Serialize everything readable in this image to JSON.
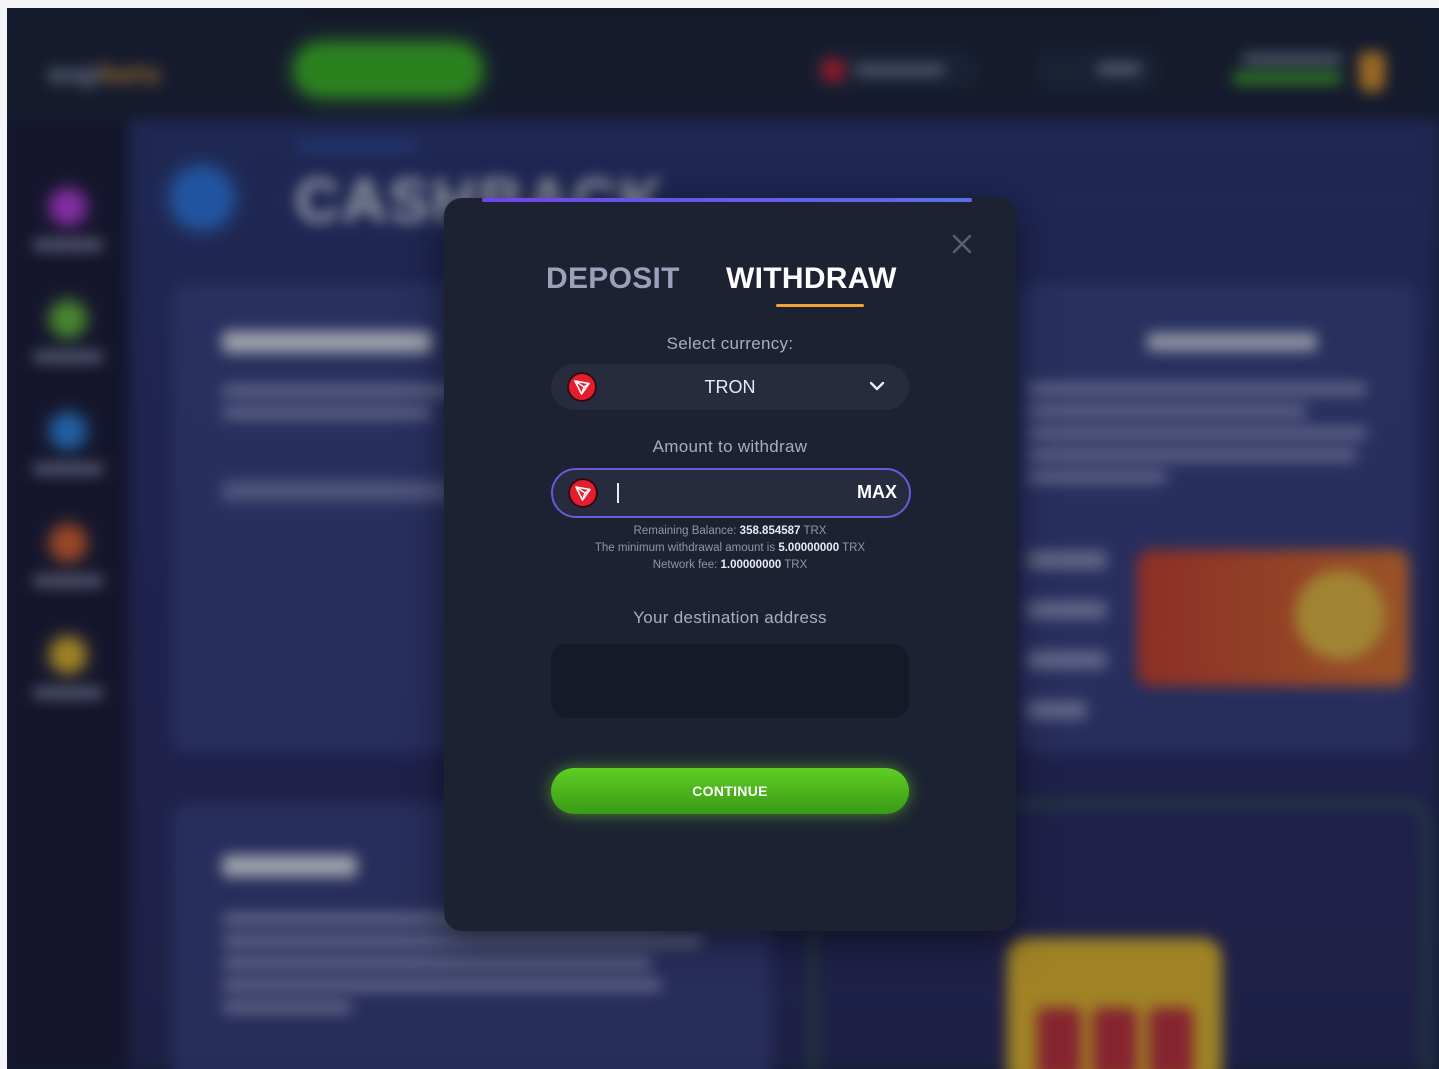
{
  "modal": {
    "tabs": {
      "deposit": "DEPOSIT",
      "withdraw": "WITHDRAW",
      "active": "WITHDRAW"
    },
    "currency_label": "Select currency:",
    "currency_selected": "TRON",
    "currency_icon": "tron-icon",
    "amount_label": "Amount to withdraw",
    "amount_value": "",
    "max_label": "MAX",
    "remaining_balance": {
      "label": "Remaining Balance:",
      "value": "358.854587",
      "unit": "TRX"
    },
    "minimum_withdrawal": {
      "label": "The minimum withdrawal amount is",
      "value": "5.00000000",
      "unit": "TRX"
    },
    "network_fee": {
      "label": "Network fee:",
      "value": "1.00000000",
      "unit": "TRX"
    },
    "address_label": "Your destination address",
    "address_value": "",
    "continue_label": "CONTINUE"
  },
  "background": {
    "page_title": "CASHBACK"
  },
  "colors": {
    "modal_bg": "#1d2233",
    "accent_underline": "#f2a33a",
    "input_border": "#6d58d8",
    "continue_green": "#4fbc1f",
    "tron_red": "#e41e2d"
  }
}
